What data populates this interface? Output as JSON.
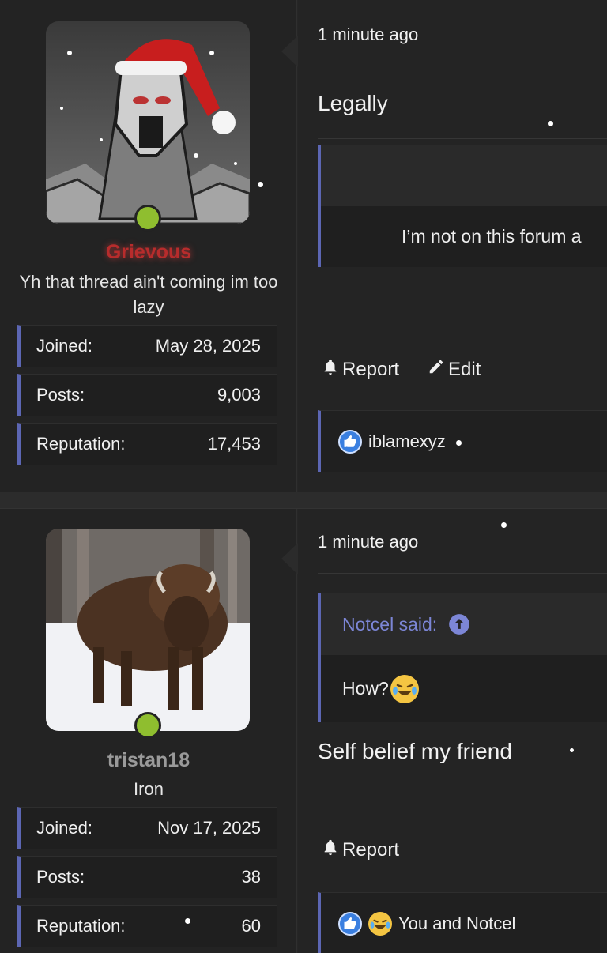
{
  "posts": [
    {
      "username": "Grievous",
      "user_title": "Yh that thread ain't coming im too lazy",
      "stats": [
        {
          "label": "Joined:",
          "value": "May 28, 2025"
        },
        {
          "label": "Posts:",
          "value": "9,003"
        },
        {
          "label": "Reputation:",
          "value": "17,453"
        }
      ],
      "time": "1 minute ago",
      "message": "Legally",
      "quote_body": "I’m not on this forum a",
      "actions": {
        "report": "Report",
        "edit": "Edit"
      },
      "reactions_text": "iblamexyz",
      "avatar_icon": "santa-hat-robot-icon"
    },
    {
      "username": "tristan18",
      "user_title": "Iron",
      "stats": [
        {
          "label": "Joined:",
          "value": "Nov 17, 2025"
        },
        {
          "label": "Posts:",
          "value": "38"
        },
        {
          "label": "Reputation:",
          "value": "60"
        }
      ],
      "time": "1 minute ago",
      "quote_author": "Notcel said:",
      "quote_body": "How?",
      "message": "Self belief my friend",
      "actions": {
        "report": "Report"
      },
      "reactions_text": "You and Notcel",
      "avatar_icon": "bison-icon"
    }
  ],
  "colors": {
    "accent": "#5c66b3",
    "online": "#8fbe2f",
    "grievous_name": "#b72c2c",
    "quote_author": "#7c86d6"
  }
}
